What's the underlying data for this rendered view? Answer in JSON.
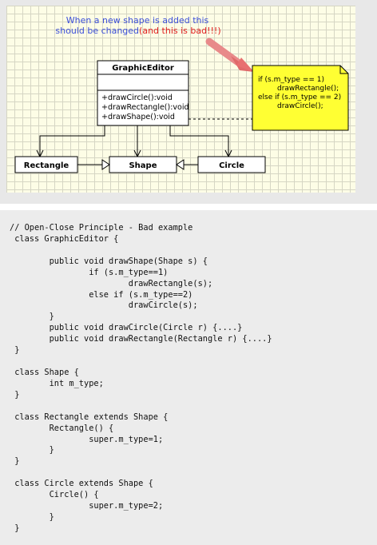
{
  "annotation": {
    "line1": "When a new shape is added this",
    "line2_prefix": "should be changed",
    "line2_warning": "(and this is bad!!!)"
  },
  "graphic_editor": {
    "name": "GraphicEditor",
    "methods": [
      "+drawCircle():void",
      "+drawRectangle():void",
      "+drawShape():void"
    ]
  },
  "note": {
    "lines": [
      "if (s.m_type == 1)",
      "drawRectangle();",
      "else if (s.m_type == 2)",
      "drawCircle();"
    ]
  },
  "classes": {
    "rectangle": "Rectangle",
    "shape": "Shape",
    "circle": "Circle"
  },
  "colors": {
    "note_fill": "#ffff33",
    "annotation_blue": "#3c4fd8",
    "annotation_red": "#e02020",
    "arrow": "#e87070"
  },
  "code_lines": [
    "// Open-Close Principle - Bad example",
    " class GraphicEditor {",
    "",
    "        public void drawShape(Shape s) {",
    "                if (s.m_type==1)",
    "                        drawRectangle(s);",
    "                else if (s.m_type==2)",
    "                        drawCircle(s);",
    "        }",
    "        public void drawCircle(Circle r) {....}",
    "        public void drawRectangle(Rectangle r) {....}",
    " }",
    "",
    " class Shape {",
    "        int m_type;",
    " }",
    "",
    " class Rectangle extends Shape {",
    "        Rectangle() {",
    "                super.m_type=1;",
    "        }",
    " }",
    "",
    " class Circle extends Shape {",
    "        Circle() {",
    "                super.m_type=2;",
    "        }",
    " }"
  ]
}
